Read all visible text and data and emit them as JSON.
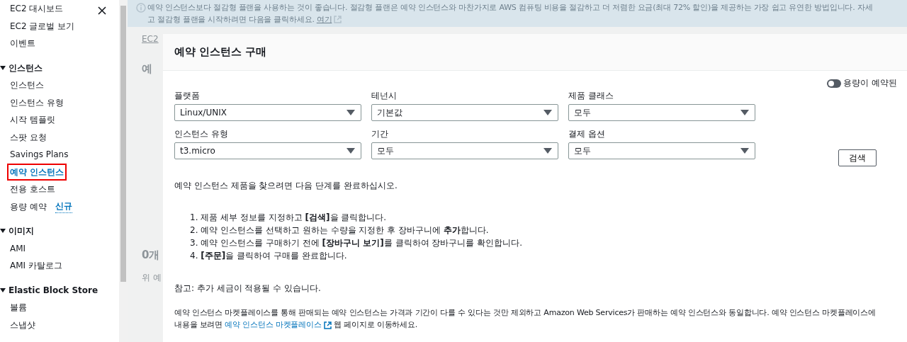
{
  "sidebar": {
    "items": [
      {
        "label": "EC2 대시보드",
        "selected": false,
        "highlighted": false
      },
      {
        "label": "EC2 글로벌 보기",
        "selected": false,
        "highlighted": false
      },
      {
        "label": "이벤트",
        "selected": false,
        "highlighted": false
      }
    ],
    "sections": [
      {
        "title": "인스턴스",
        "expanded": true,
        "items": [
          {
            "label": "인스턴스",
            "selected": false,
            "highlighted": false
          },
          {
            "label": "인스턴스 유형",
            "selected": false,
            "highlighted": false
          },
          {
            "label": "시작 템플릿",
            "selected": false,
            "highlighted": false
          },
          {
            "label": "스팟 요청",
            "selected": false,
            "highlighted": false
          },
          {
            "label": "Savings Plans",
            "selected": false,
            "highlighted": false
          },
          {
            "label": "예약 인스턴스",
            "selected": true,
            "highlighted": true
          },
          {
            "label": "전용 호스트",
            "selected": false,
            "highlighted": false
          },
          {
            "label": "용량 예약",
            "selected": false,
            "highlighted": false,
            "badge": "신규"
          }
        ]
      },
      {
        "title": "이미지",
        "expanded": true,
        "items": [
          {
            "label": "AMI",
            "selected": false,
            "highlighted": false
          },
          {
            "label": "AMI 카탈로그",
            "selected": false,
            "highlighted": false
          }
        ]
      },
      {
        "title": "Elastic Block Store",
        "expanded": true,
        "items": [
          {
            "label": "볼륨",
            "selected": false,
            "highlighted": false
          },
          {
            "label": "스냅샷",
            "selected": false,
            "highlighted": false
          }
        ]
      }
    ]
  },
  "banner": {
    "line_1": "예약 인스턴스보다 절감형 플랜을 사용하는 것이 좋습니다. 절감형 플랜은 예약 인스턴스와 마찬가지로 AWS 컴퓨팅 비용을 절감하고 더 저렴한 요금(최대 72% 할인)을 제공하는 가장 쉽고 유연한 방법입니다. 자세",
    "line_2": "고 절감형 플랜을 시작하려면 다음을 클릭하세요.",
    "link": "여기"
  },
  "background": {
    "breadcrumb": "EC2",
    "panel_title": "예",
    "count": "0개",
    "hint": "위 예"
  },
  "modal": {
    "title": "예약 인스턴스 구매",
    "toggle": {
      "label": "용량이 예약된",
      "on": false
    },
    "filters": [
      {
        "label": "플랫폼",
        "value": "Linux/UNIX"
      },
      {
        "label": "테넌시",
        "value": "기본값"
      },
      {
        "label": "제품 클래스",
        "value": "모두"
      },
      {
        "label": "인스턴스 유형",
        "value": "t3.micro"
      },
      {
        "label": "기간",
        "value": "모두"
      },
      {
        "label": "결제 옵션",
        "value": "모두"
      }
    ],
    "search_button": "검색",
    "intro": "예약 인스턴스 제품을 찾으려면 다음 단계를 완료하십시오.",
    "steps": [
      "1. 제품 세부 정보를 지정하고 **[검색]**을 클릭합니다.",
      "2. 예약 인스턴스를 선택하고 원하는 수량을 지정한 후 장바구니에 **추가**합니다.",
      "3. 예약 인스턴스를 구매하기 전에 **[장바구니 보기]**를 클릭하여 장바구니를 확인합니다.",
      "4. **[주문]**을 클릭하여 구매를 완료합니다."
    ],
    "note": "참고: 추가 세금이 적용될 수 있습니다.",
    "marketplace": {
      "line_1": "예약 인스턴스 마켓플레이스를 통해 판매되는 예약 인스턴스는 가격과 기간이 다를 수 있다는 것만 제외하고 Amazon Web Services가 판매하는 예약 인스턴스와 동일합니다. 예약 인스턴스 마켓플레이스에",
      "line_2_before": "내용을 보려면",
      "link": "예약 인스턴스 마켓플레이스",
      "line_2_after": "웹 페이지로 이동하세요."
    }
  }
}
